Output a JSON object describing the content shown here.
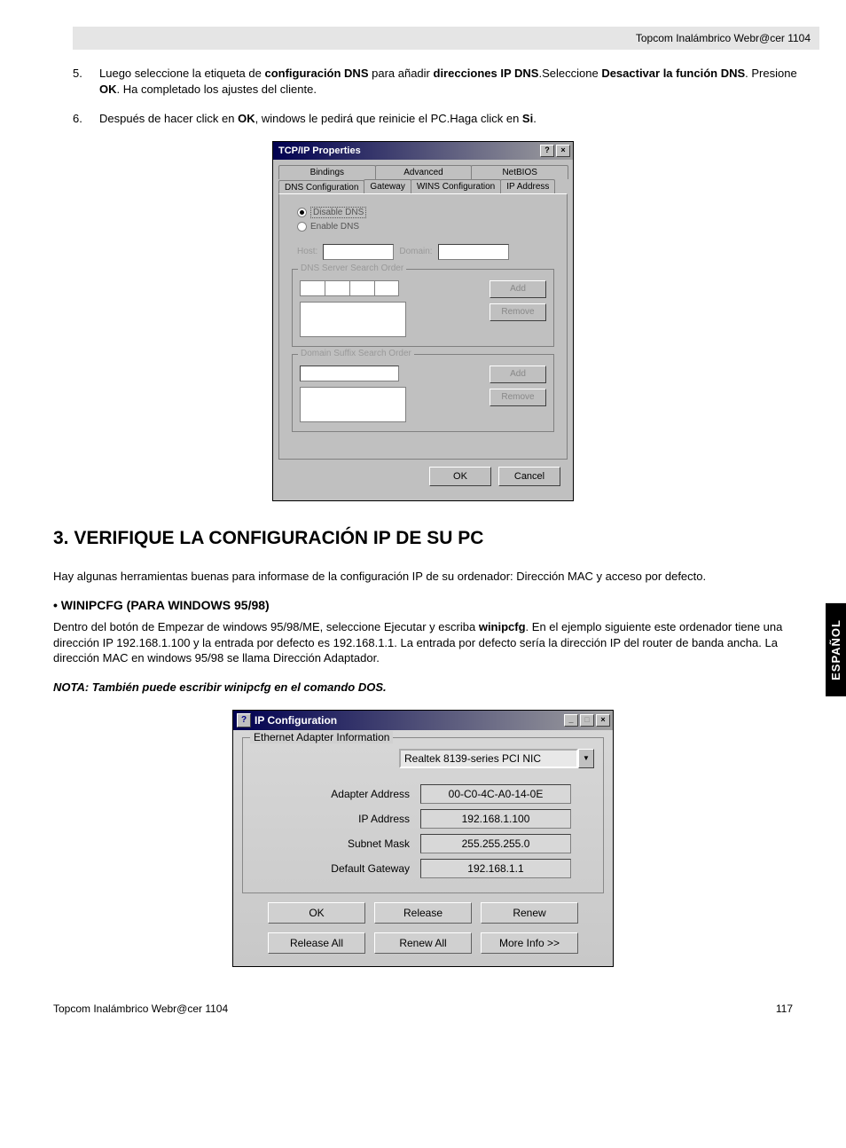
{
  "header": {
    "product": "Topcom Inalámbrico Webr@cer 1104"
  },
  "list": {
    "item5": {
      "num": "5.",
      "t1": "Luego seleccione la etiqueta de ",
      "b1": "configuración DNS",
      "t2": " para añadir ",
      "b2": "direcciones IP DNS",
      "t3": ".Seleccione ",
      "b3": "Desactivar la función DNS",
      "t4": ". Presione ",
      "b4": "OK",
      "t5": ". Ha completado los ajustes del cliente."
    },
    "item6": {
      "num": "6.",
      "t1": "Después de hacer click en ",
      "b1": "OK",
      "t2": ", windows le pedirá que reinicie el PC.Haga click en ",
      "b2": "Si",
      "t3": "."
    }
  },
  "dialog1": {
    "title": "TCP/IP Properties",
    "tabs_row1": [
      "Bindings",
      "Advanced",
      "NetBIOS"
    ],
    "tabs_row2": [
      "DNS Configuration",
      "Gateway",
      "WINS Configuration",
      "IP Address"
    ],
    "radio_disable": "Disable DNS",
    "radio_enable": "Enable DNS",
    "host_label": "Host:",
    "domain_label": "Domain:",
    "group_dns": "DNS Server Search Order",
    "group_suffix": "Domain Suffix Search Order",
    "btn_add": "Add",
    "btn_remove": "Remove",
    "btn_ok": "OK",
    "btn_cancel": "Cancel"
  },
  "section": {
    "title": "3. VERIFIQUE LA CONFIGURACIÓN IP DE SU PC",
    "para1": "Hay algunas herramientas buenas para informase de la configuración IP de su ordenador: Dirección MAC y acceso por defecto.",
    "sub": "• WINIPCFG (PARA WINDOWS 95/98)",
    "para2a": "Dentro del botón de Empezar de windows 95/98/ME, seleccione Ejecutar y escriba ",
    "para2b": "winipcfg",
    "para2c": ". En el ejemplo siguiente este ordenador tiene una dirección IP 192.168.1.100 y la entrada por defecto es 192.168.1.1. La entrada por defecto sería la dirección IP del router de banda ancha. La dirección MAC en windows 95/98 se llama Dirección Adaptador.",
    "note": "NOTA: También puede escribir winipcfg en el comando DOS."
  },
  "dialog2": {
    "title": "IP Configuration",
    "fieldset": "Ethernet Adapter Information",
    "adapter": "Realtek 8139-series PCI NIC",
    "rows": {
      "adapter_addr": {
        "label": "Adapter Address",
        "value": "00-C0-4C-A0-14-0E"
      },
      "ip": {
        "label": "IP Address",
        "value": "192.168.1.100"
      },
      "mask": {
        "label": "Subnet Mask",
        "value": "255.255.255.0"
      },
      "gw": {
        "label": "Default Gateway",
        "value": "192.168.1.1"
      }
    },
    "btns": {
      "ok": "OK",
      "release": "Release",
      "renew": "Renew",
      "release_all": "Release All",
      "renew_all": "Renew All",
      "more": "More Info >>"
    }
  },
  "sidetab": "ESPAÑOL",
  "footer": {
    "left": "Topcom Inalámbrico Webr@cer 1104",
    "right": "117"
  }
}
